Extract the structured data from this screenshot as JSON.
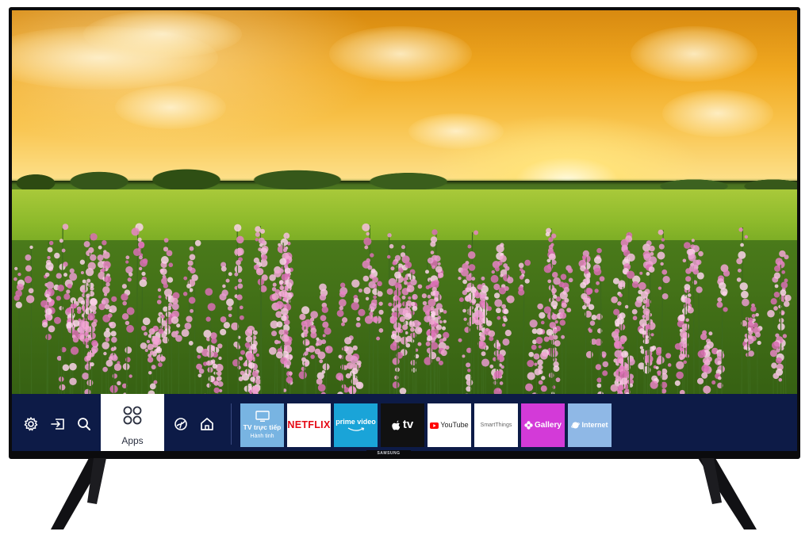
{
  "device": {
    "brand_logo": "SAMSUNG",
    "frame_color": "#0b0b0d"
  },
  "hub": {
    "background_color": "#0d1b47",
    "left_icons": [
      {
        "name": "settings-icon"
      },
      {
        "name": "source-input-icon"
      },
      {
        "name": "search-icon"
      }
    ],
    "apps_tile": {
      "label": "Apps",
      "icon": "apps-grid-icon"
    },
    "right_icons": [
      {
        "name": "ambient-mode-icon"
      },
      {
        "name": "home-icon"
      }
    ],
    "apps": [
      {
        "id": "live-tv",
        "line1": "TV trực tiếp",
        "line2": "Hành tinh",
        "bg": "#78b4e2",
        "fg": "#ffffff",
        "icon": "tv-icon"
      },
      {
        "id": "netflix",
        "label": "NETFLIX",
        "bg": "#ffffff",
        "fg": "#e50914"
      },
      {
        "id": "prime-video",
        "label": "prime video",
        "bg": "#1aa4d8",
        "fg": "#ffffff"
      },
      {
        "id": "apple-tv",
        "label": "tv",
        "bg": "#111111",
        "fg": "#ffffff",
        "icon": "apple-icon"
      },
      {
        "id": "youtube",
        "label": "YouTube",
        "bg": "#ffffff",
        "fg": "#222222",
        "icon": "youtube-play-icon"
      },
      {
        "id": "smartthings",
        "label": "SmartThings",
        "bg": "#ffffff",
        "fg": "#666666"
      },
      {
        "id": "gallery",
        "label": "Gallery",
        "bg": "#d33ad8",
        "fg": "#ffffff",
        "icon": "flower-icon"
      },
      {
        "id": "internet",
        "label": "Internet",
        "bg": "#8fb8e6",
        "fg": "#ffffff",
        "icon": "planet-icon"
      }
    ]
  }
}
